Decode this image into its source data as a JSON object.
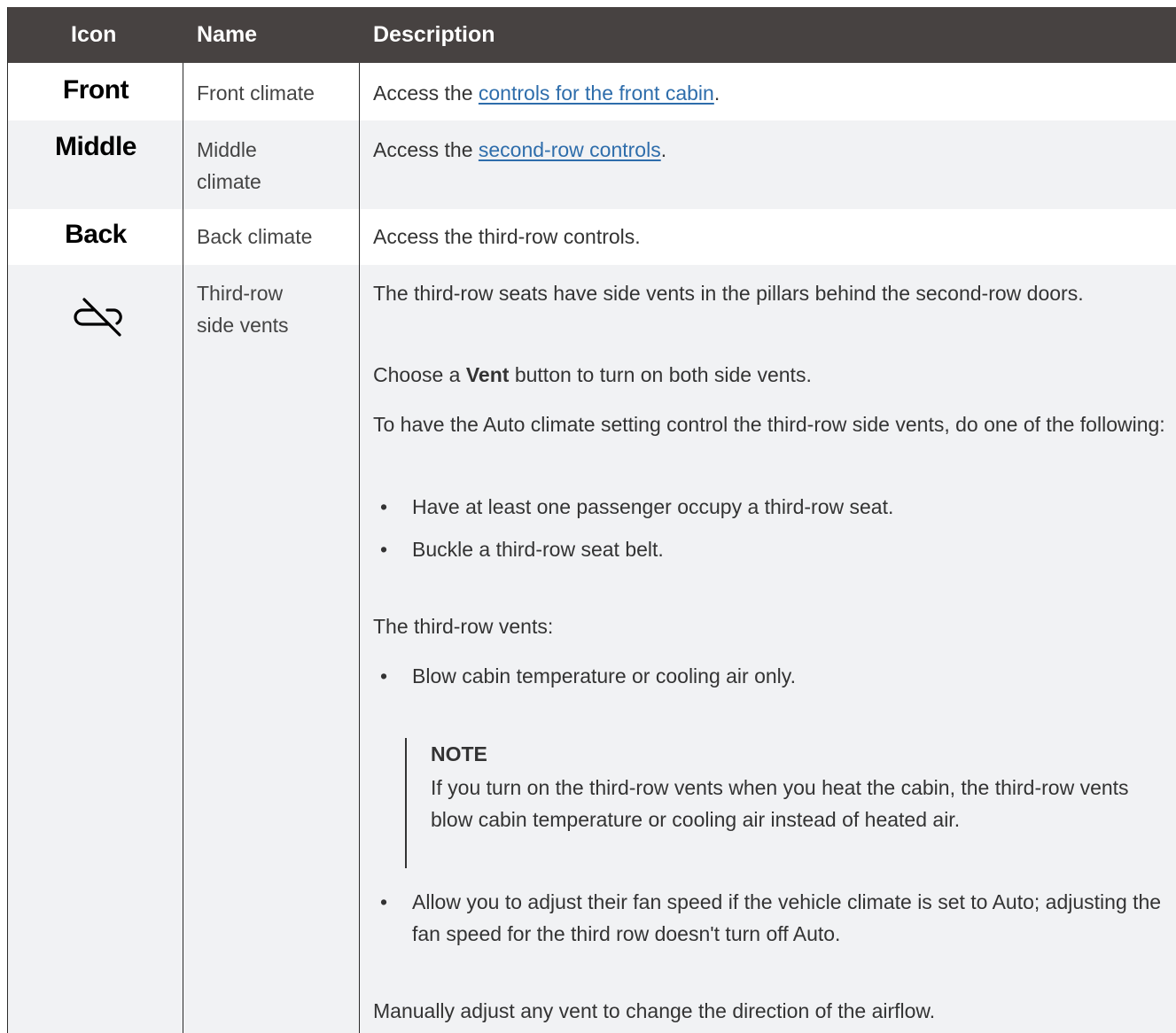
{
  "header": {
    "icon": "Icon",
    "name": "Name",
    "description": "Description"
  },
  "rows": [
    {
      "icon_text": "Front",
      "name": "Front climate",
      "desc_prefix": "Access the ",
      "desc_link": "controls for the front cabin",
      "desc_suffix": "."
    },
    {
      "icon_text": "Middle",
      "name": "Middle climate",
      "desc_prefix": "Access the ",
      "desc_link": "second-row controls",
      "desc_suffix": "."
    },
    {
      "icon_text": "Back",
      "name": "Back climate",
      "desc": "Access the third-row controls."
    },
    {
      "icon": "vent-off-icon",
      "name": "Third-row side vents",
      "p1": "The third-row seats have side vents in the pillars behind the second-row doors.",
      "p2_prefix": "Choose a ",
      "p2_bold": "Vent",
      "p2_suffix": " button to turn on both side vents.",
      "p3": "To have the Auto climate setting control the third-row side vents, do one of the following:",
      "bullets_a": [
        "Have at least one passenger occupy a third-row seat.",
        "Buckle a third-row seat belt."
      ],
      "p4": "The third-row vents:",
      "bullet_b1": "Blow cabin temperature or cooling air only.",
      "note_title": "NOTE",
      "note_body": "If you turn on the third-row vents when you heat the cabin, the third-row vents blow cabin temperature or cooling air instead of heated air.",
      "bullet_b2": "Allow you to adjust their fan speed if the vehicle climate is set to Auto; adjusting the fan speed for the third row doesn't turn off Auto.",
      "p5": "Manually adjust any vent to change the direction of the airflow."
    }
  ]
}
